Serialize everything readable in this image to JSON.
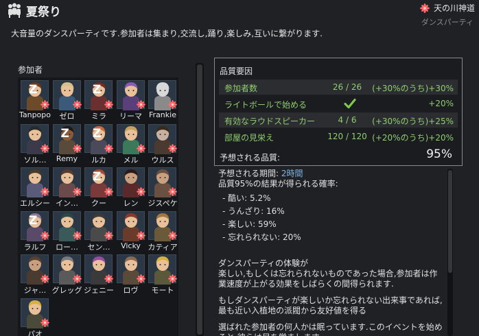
{
  "header": {
    "title": "夏祭り",
    "faction": "天の川神道",
    "subtitle": "ダンスパーティ"
  },
  "description": "大音量のダンスパーティです.参加者は集まり,交流し,踊り,楽しみ,互いに繋がります.",
  "participants": {
    "label": "参加者",
    "items": [
      {
        "name": "Tanpopo",
        "sleeping": true,
        "hair": "#6b3a1c",
        "skin": "#e8c19a",
        "body": "#6d4a2a"
      },
      {
        "name": "ゼロ",
        "sleeping": false,
        "hair": "#d6c08a",
        "skin": "#e8c19a",
        "body": "#3b5a7a"
      },
      {
        "name": "ミラ",
        "sleeping": true,
        "hair": "#7a2a1c",
        "skin": "#e8c19a",
        "body": "#6a2f2f"
      },
      {
        "name": "リーマ",
        "sleeping": false,
        "hair": "#8a5bb0",
        "skin": "#e8c19a",
        "body": "#5a3f7a"
      },
      {
        "name": "Frankie",
        "sleeping": false,
        "hair": "#d8d8d8",
        "skin": "#d8d8d8",
        "body": "#8a8a8a"
      },
      {
        "name": "ソル…",
        "sleeping": false,
        "hair": "#2a2a2a",
        "skin": "#e8c19a",
        "body": "#3a3a4a"
      },
      {
        "name": "Remy",
        "sleeping": true,
        "hair": "#1f1a16",
        "skin": "#8a5a3a",
        "body": "#5a4a3a"
      },
      {
        "name": "ルカ",
        "sleeping": true,
        "hair": "#c86a3a",
        "skin": "#e8c19a",
        "body": "#4a4a5a"
      },
      {
        "name": "メル",
        "sleeping": false,
        "hair": "#c8a060",
        "skin": "#e8c19a",
        "body": "#3a7a5a"
      },
      {
        "name": "ウルス",
        "sleeping": false,
        "hair": "#3a2a1a",
        "skin": "#c8b0a0",
        "body": "#4a3a30"
      },
      {
        "name": "エルシー",
        "sleeping": false,
        "hair": "#4a3a2a",
        "skin": "#e8c19a",
        "body": "#5a5a7a"
      },
      {
        "name": "イン…",
        "sleeping": false,
        "hair": "#5a3a2a",
        "skin": "#e8c19a",
        "body": "#6a4a4a"
      },
      {
        "name": "クー",
        "sleeping": true,
        "hair": "#a04a3a",
        "skin": "#e8c19a",
        "body": "#7a3a3a"
      },
      {
        "name": "レン",
        "sleeping": false,
        "hair": "#2a1a1a",
        "skin": "#c8a080",
        "body": "#5a2a2a"
      },
      {
        "name": "ジスペケ",
        "sleeping": false,
        "hair": "#6a5040",
        "skin": "#c8a080",
        "body": "#6a5040"
      },
      {
        "name": "ラルフ",
        "sleeping": true,
        "hair": "#8a7a90",
        "skin": "#e8c19a",
        "body": "#5a4a6a"
      },
      {
        "name": "ロー…",
        "sleeping": false,
        "hair": "#2a4a4a",
        "skin": "#e8c19a",
        "body": "#3a5a5a"
      },
      {
        "name": "セン…",
        "sleeping": false,
        "hair": "#3a3a3a",
        "skin": "#e8c19a",
        "body": "#4a4a4a"
      },
      {
        "name": "Vicky",
        "sleeping": false,
        "hair": "#8a3a2a",
        "skin": "#e8c19a",
        "body": "#6a3a2a"
      },
      {
        "name": "カティア",
        "sleeping": false,
        "hair": "#a07840",
        "skin": "#e8c19a",
        "body": "#6a5a3a"
      },
      {
        "name": "ジャ…",
        "sleeping": false,
        "hair": "#5a4030",
        "skin": "#c8a080",
        "body": "#4a3a30"
      },
      {
        "name": "グレッグ",
        "sleeping": false,
        "hair": "#7a7a7a",
        "skin": "#e8c19a",
        "body": "#5a5a5a"
      },
      {
        "name": "ジェニー",
        "sleeping": false,
        "hair": "#9a4aa0",
        "skin": "#e8c19a",
        "body": "#3a3a3a"
      },
      {
        "name": "ロヴ",
        "sleeping": false,
        "hair": "#8a6a50",
        "skin": "#e8c19a",
        "body": "#5a4a3a"
      },
      {
        "name": "モート",
        "sleeping": false,
        "hair": "#d8b040",
        "skin": "#e8c19a",
        "body": "#5a5a3a"
      },
      {
        "name": "パオ",
        "sleeping": false,
        "hair": "#d8b040",
        "skin": "#e8c19a",
        "body": "#4a4a3a"
      }
    ]
  },
  "quality": {
    "title": "品質要因",
    "rows": [
      {
        "label": "参加者数",
        "value": "26 / 26",
        "check": false,
        "bonus": "(+30%のうち)+30%"
      },
      {
        "label": "ライトボールで始める",
        "value": "",
        "check": true,
        "bonus": "+20%"
      },
      {
        "label": "有効なラウドスピーカー",
        "value": "4 / 6",
        "check": false,
        "bonus": "(+30%のうち)+25%"
      },
      {
        "label": "部屋の見栄え",
        "value": "120 / 120",
        "check": false,
        "bonus": "(+20%のうち)+20%"
      }
    ],
    "expected_label": "予想される品質:",
    "expected_value": "95%"
  },
  "details": {
    "duration_label": "予想される期間: ",
    "duration_value": "2時間",
    "prob_heading": "品質95%の結果が得られる確率:",
    "outcomes": [
      "- 酷い: 5.2%",
      "- うんざり: 16%",
      "- 楽しい: 59%",
      "- 忘れられない: 20%"
    ],
    "effect_1": "ダンスパーティの体験が",
    "effect_2": "楽しい,もしくは忘れられないものであった場合,参加者は作業速度が上がる効果をしばらくの間得られます.",
    "effect_3": "もしダンスパーティが楽しいか忘れられない出来事であれば,最も近い入植地の派閥から友好値を得る",
    "effect_4": "選ばれた参加者の何人かは眠っています.このイベントを始めると,彼らは目を覚まします."
  },
  "colors": {
    "positive": "#8fce6f",
    "highlight": "#7fb7e9",
    "faction_mark": "#ff6b6b"
  },
  "icons": {
    "title": "party-icon",
    "faction": "faction-flower-icon",
    "sleeping": "sleep-z-icon",
    "check": "checkmark-icon"
  }
}
